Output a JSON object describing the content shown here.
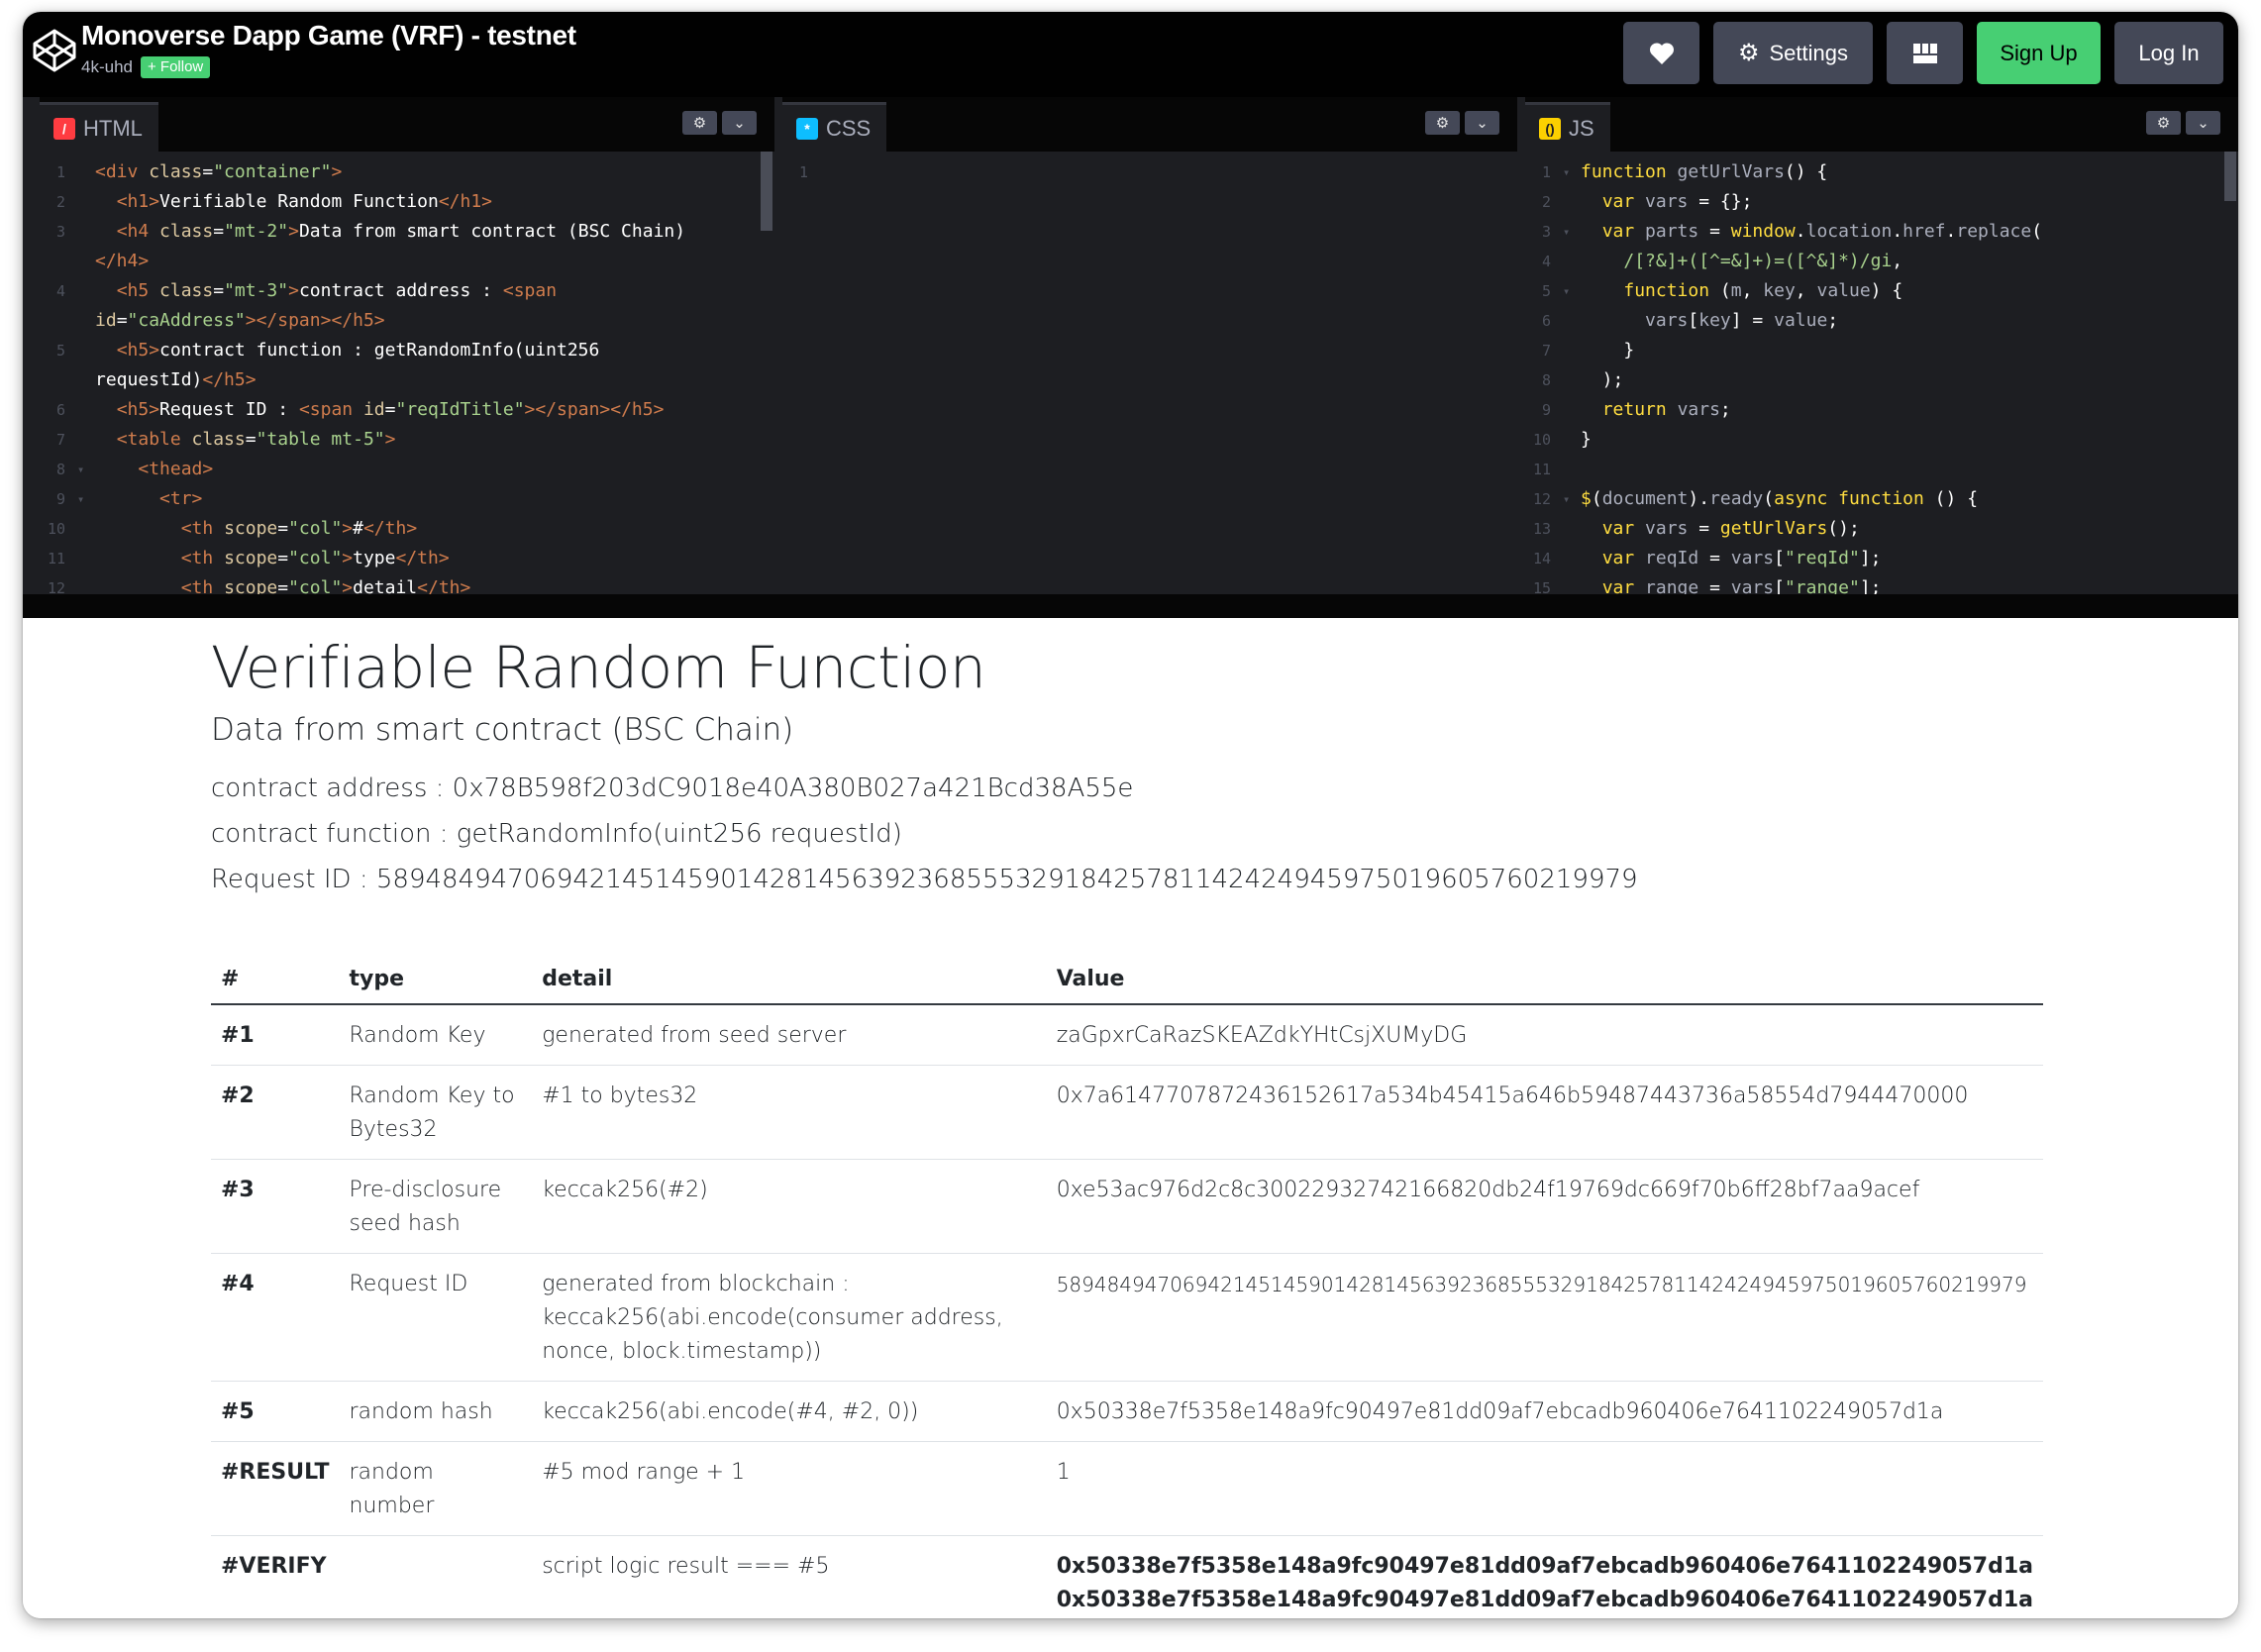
{
  "header": {
    "title": "Monoverse Dapp Game (VRF) - testnet",
    "author": "4k-uhd",
    "follow_label": "+ Follow",
    "settings_label": "Settings",
    "signup_label": "Sign Up",
    "login_label": "Log In",
    "colors": {
      "signup": "#47cf73",
      "button": "#444857",
      "bar": "#010101"
    }
  },
  "editors": {
    "html": {
      "label": "HTML",
      "icon": "html-slash-icon",
      "lines": [
        {
          "n": "1",
          "text": "<div class=\"container\">"
        },
        {
          "n": "2",
          "text": "  <h1>Verifiable Random Function</h1>"
        },
        {
          "n": "3",
          "text": "  <h4 class=\"mt-2\">Data from smart contract (BSC Chain)"
        },
        {
          "n": "",
          "text": "</h4>"
        },
        {
          "n": "4",
          "text": "  <h5 class=\"mt-3\">contract address : <span"
        },
        {
          "n": "",
          "text": "id=\"caAddress\"></span></h5>"
        },
        {
          "n": "5",
          "text": "  <h5>contract function : getRandomInfo(uint256"
        },
        {
          "n": "",
          "text": "requestId)</h5>"
        },
        {
          "n": "6",
          "text": "  <h5>Request ID : <span id=\"reqIdTitle\"></span></h5>"
        },
        {
          "n": "7",
          "text": "  <table class=\"table mt-5\">"
        },
        {
          "n": "8",
          "text": "    <thead>"
        },
        {
          "n": "9",
          "text": "      <tr>"
        },
        {
          "n": "10",
          "text": "        <th scope=\"col\">#</th>"
        },
        {
          "n": "11",
          "text": "        <th scope=\"col\">type</th>"
        },
        {
          "n": "12",
          "text": "        <th scope=\"col\">detail</th>"
        }
      ]
    },
    "css": {
      "label": "CSS",
      "icon": "css-asterisk-icon",
      "lines": [
        {
          "n": "1",
          "text": ""
        }
      ]
    },
    "js": {
      "label": "JS",
      "icon": "js-braces-icon",
      "lines": [
        {
          "n": "1",
          "text": "function getUrlVars() {"
        },
        {
          "n": "2",
          "text": "  var vars = {};"
        },
        {
          "n": "3",
          "text": "  var parts = window.location.href.replace("
        },
        {
          "n": "4",
          "text": "    /[?&]+([^=&]+)=([^&]*)/gi,"
        },
        {
          "n": "5",
          "text": "    function (m, key, value) {"
        },
        {
          "n": "6",
          "text": "      vars[key] = value;"
        },
        {
          "n": "7",
          "text": "    }"
        },
        {
          "n": "8",
          "text": "  );"
        },
        {
          "n": "9",
          "text": "  return vars;"
        },
        {
          "n": "10",
          "text": "}"
        },
        {
          "n": "11",
          "text": ""
        },
        {
          "n": "12",
          "text": "$(document).ready(async function () {"
        },
        {
          "n": "13",
          "text": "  var vars = getUrlVars();"
        },
        {
          "n": "14",
          "text": "  var reqId = vars[\"reqId\"];"
        },
        {
          "n": "15",
          "text": "  var range = vars[\"range\"];"
        }
      ]
    }
  },
  "result": {
    "h1": "Verifiable Random Function",
    "h4": "Data from smart contract (BSC Chain)",
    "contract_address_line": "contract address : 0x78B598f203dC9018e40A380B027a421Bcd38A55e",
    "contract_function_line": "contract function : getRandomInfo(uint256 requestId)",
    "request_id_line": "Request ID : 58948494706942145145901428145639236855532918425781142424945975019605760219979",
    "table": {
      "headers": [
        "#",
        "type",
        "detail",
        "Value"
      ],
      "rows": [
        {
          "idx": "#1",
          "type": "Random Key",
          "detail": "generated from seed server",
          "value": "zaGpxrCaRazSKEAZdkYHtCsjXUMyDG"
        },
        {
          "idx": "#2",
          "type": "Random Key to Bytes32",
          "detail": "#1 to bytes32",
          "value": "0x7a6147707872436152617a534b45415a646b59487443736a58554d7944470000"
        },
        {
          "idx": "#3",
          "type": "Pre-disclosure seed hash",
          "detail": "keccak256(#2)",
          "value": "0xe53ac976d2c8c30022932742166820db24f19769dc669f70b6ff28bf7aa9acef"
        },
        {
          "idx": "#4",
          "type": "Request ID",
          "detail": "generated from blockchain : keccak256(abi.encode(consumer address, nonce, block.timestamp))",
          "value": "58948494706942145145901428145639236855532918425781142424945975019605760219979"
        },
        {
          "idx": "#5",
          "type": "random hash",
          "detail": "keccak256(abi.encode(#4, #2, 0))",
          "value": "0x50338e7f5358e148a9fc90497e81dd09af7ebcadb960406e7641102249057d1a"
        },
        {
          "idx": "#RESULT",
          "type": "random number",
          "detail": "#5 mod range + 1",
          "value": "1"
        }
      ],
      "verify": {
        "idx": "#VERIFY",
        "type": "",
        "detail": "script logic result === #5",
        "values": [
          "0x50338e7f5358e148a9fc90497e81dd09af7ebcadb960406e7641102249057d1a",
          "0x50338e7f5358e148a9fc90497e81dd09af7ebcadb960406e7641102249057d1a",
          "true"
        ]
      }
    }
  }
}
